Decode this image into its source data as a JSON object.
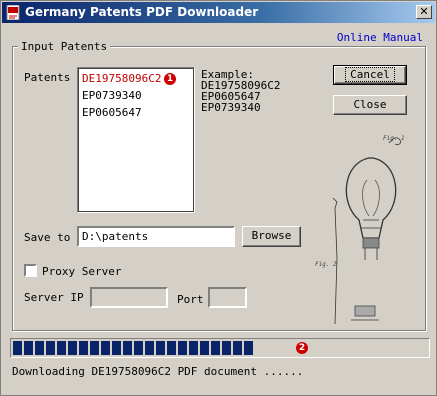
{
  "window": {
    "title": "Germany Patents PDF Downloader",
    "close_glyph": "✕"
  },
  "header": {
    "online_manual": "Online Manual"
  },
  "group": {
    "title": "Input Patents"
  },
  "patents": {
    "label": "Patents",
    "items": [
      "DE19758096C2",
      "EP0739340",
      "EP0605647"
    ],
    "active_marker": "1"
  },
  "example": {
    "title": "Example:",
    "lines": [
      "DE19758096C2",
      "EP0605647",
      "EP0739340"
    ]
  },
  "buttons": {
    "cancel": "Cancel",
    "close": "Close",
    "browse": "Browse"
  },
  "save_to": {
    "label": "Save to",
    "value": "D:\\patents"
  },
  "proxy": {
    "label": "Proxy Server",
    "checked": false,
    "server_ip_label": "Server IP",
    "server_ip": "",
    "port_label": "Port",
    "port": ""
  },
  "progress": {
    "fraction": 0.58,
    "marker": "2"
  },
  "status": {
    "text": "Downloading DE19758096C2 PDF document ......"
  }
}
